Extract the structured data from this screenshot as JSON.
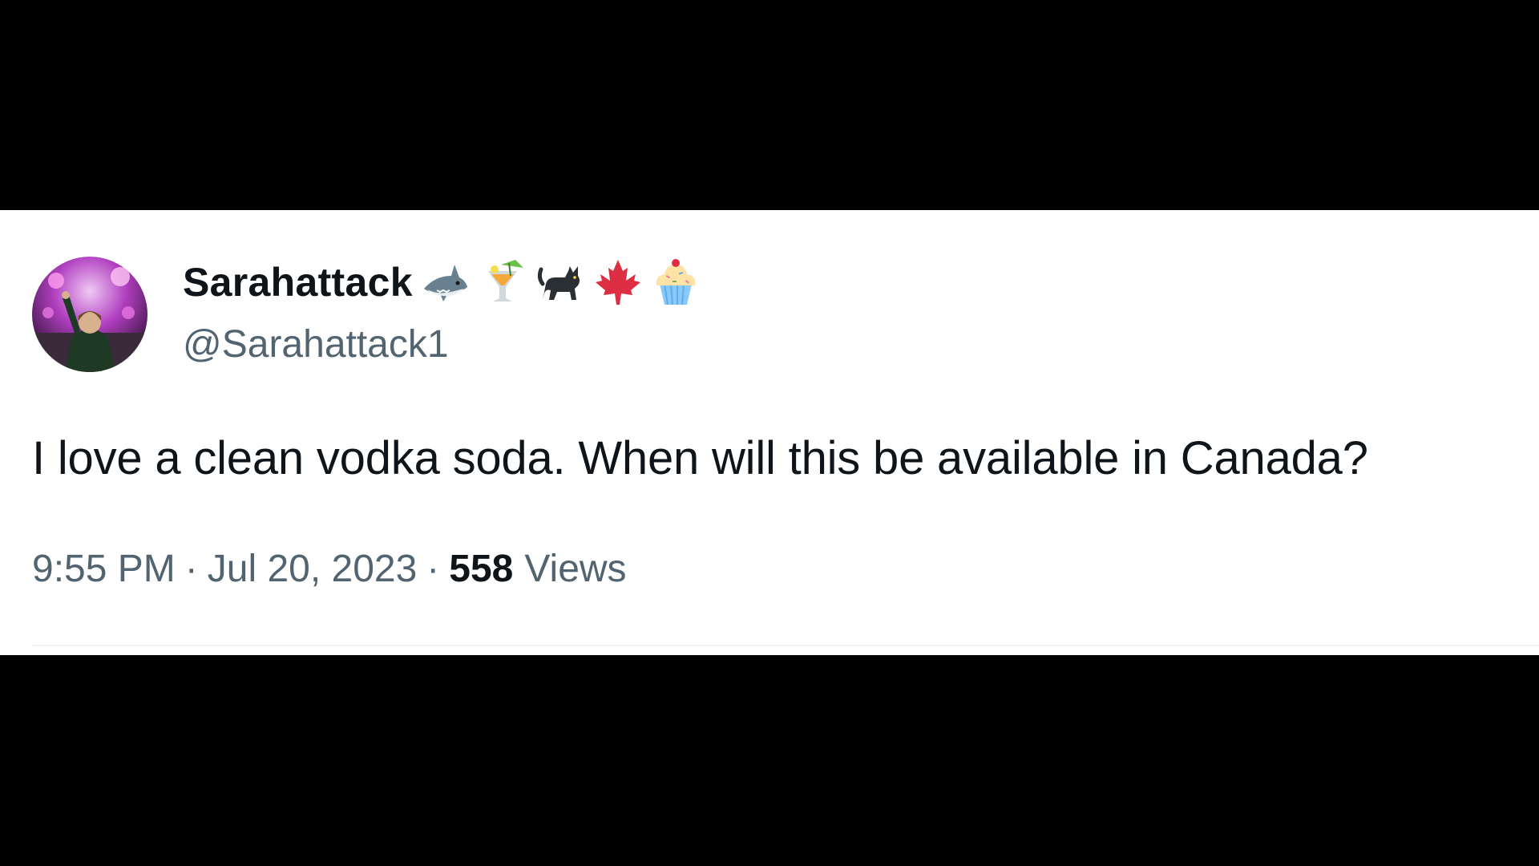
{
  "tweet": {
    "display_name": "Sarahattack",
    "name_emojis": [
      "shark-icon",
      "tropical-drink-icon",
      "black-cat-icon",
      "maple-leaf-icon",
      "cupcake-icon"
    ],
    "handle": "@Sarahattack1",
    "text": "I love a clean vodka soda. When will this be available in Canada?",
    "time": "9:55 PM",
    "separator": "·",
    "date": "Jul 20, 2023",
    "views_count": "558",
    "views_label": "Views"
  },
  "colors": {
    "background": "#000000",
    "card": "#ffffff",
    "primary_text": "#0f1419",
    "secondary_text": "#536471",
    "divider": "#eff3f4"
  }
}
